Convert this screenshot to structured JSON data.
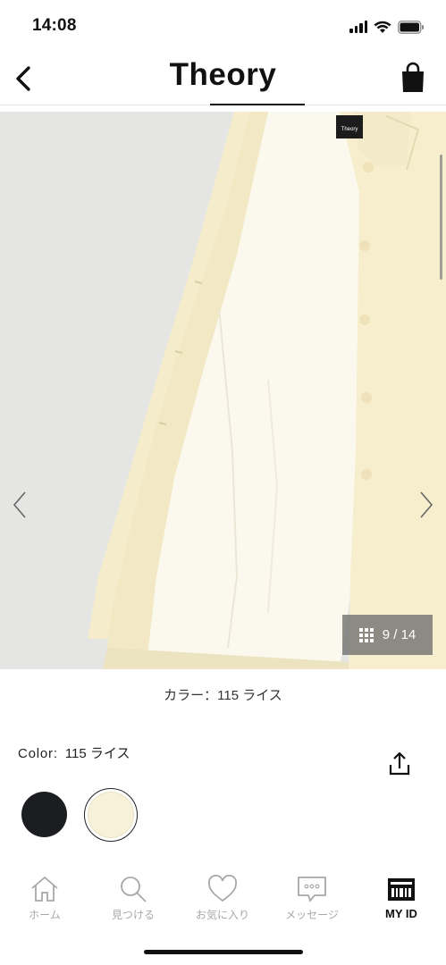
{
  "status_bar": {
    "time": "14:08"
  },
  "header": {
    "brand": "Theory",
    "back_icon": "chevron-left-icon",
    "bag_icon": "shopping-bag-icon"
  },
  "gallery": {
    "image_description_tag": "Theory",
    "counter": "9 / 14",
    "current_index": 9,
    "total": 14
  },
  "color_caption": "カラー：115 ライス",
  "color_selector": {
    "label": "Color:",
    "value": "115 ライス",
    "swatches": [
      {
        "name": "black",
        "color": "#1c1d21",
        "selected": false
      },
      {
        "name": "rice",
        "color": "#f8f1d9",
        "selected": true
      }
    ]
  },
  "tabbar": {
    "tabs": [
      {
        "label": "ホーム",
        "icon": "home-icon",
        "active": false
      },
      {
        "label": "見つける",
        "icon": "search-icon",
        "active": false
      },
      {
        "label": "お気に入り",
        "icon": "heart-icon",
        "active": false
      },
      {
        "label": "メッセージ",
        "icon": "message-icon",
        "active": false
      },
      {
        "label": "MY ID",
        "icon": "barcode-icon",
        "active": true
      }
    ]
  },
  "colors": {
    "inactive_tab": "#a8a8a8",
    "active_tab": "#111111",
    "coat": "#f7efcd"
  }
}
